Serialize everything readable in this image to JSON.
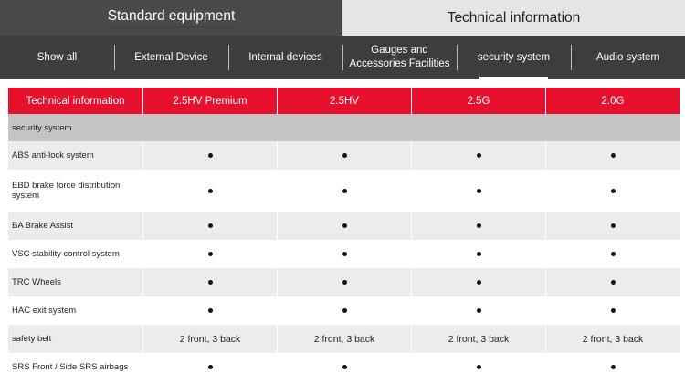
{
  "top_tabs": {
    "standard": "Standard equipment",
    "technical": "Technical information"
  },
  "sub_nav": [
    "Show all",
    "External Device",
    "Internal devices",
    "Gauges and Accessories Facilities",
    "security system",
    "Audio system"
  ],
  "table": {
    "header": [
      "Technical information",
      "2.5HV Premium",
      "2.5HV",
      "2.5G",
      "2.0G"
    ],
    "section": "security system",
    "rows": [
      {
        "label": "ABS anti-lock system",
        "values": [
          "●",
          "●",
          "●",
          "●"
        ]
      },
      {
        "label": "EBD brake force distribution system",
        "values": [
          "●",
          "●",
          "●",
          "●"
        ]
      },
      {
        "label": "BA Brake Assist",
        "values": [
          "●",
          "●",
          "●",
          "●"
        ]
      },
      {
        "label": "VSC stability control system",
        "values": [
          "●",
          "●",
          "●",
          "●"
        ]
      },
      {
        "label": "TRC Wheels",
        "values": [
          "●",
          "●",
          "●",
          "●"
        ]
      },
      {
        "label": "HAC exit system",
        "values": [
          "●",
          "●",
          "●",
          "●"
        ]
      },
      {
        "label": "safety belt",
        "values": [
          "2 front, 3 back",
          "2 front, 3 back",
          "2 front, 3 back",
          "2 front, 3 back"
        ]
      },
      {
        "label": "SRS Front / Side SRS airbags",
        "values": [
          "●",
          "●",
          "●",
          "●"
        ]
      }
    ]
  },
  "colors": {
    "accent_red": "#e8112d",
    "nav_dark": "#3d3d3d",
    "tab_active": "#4a4a4a",
    "section_gray": "#c4c4c4"
  }
}
